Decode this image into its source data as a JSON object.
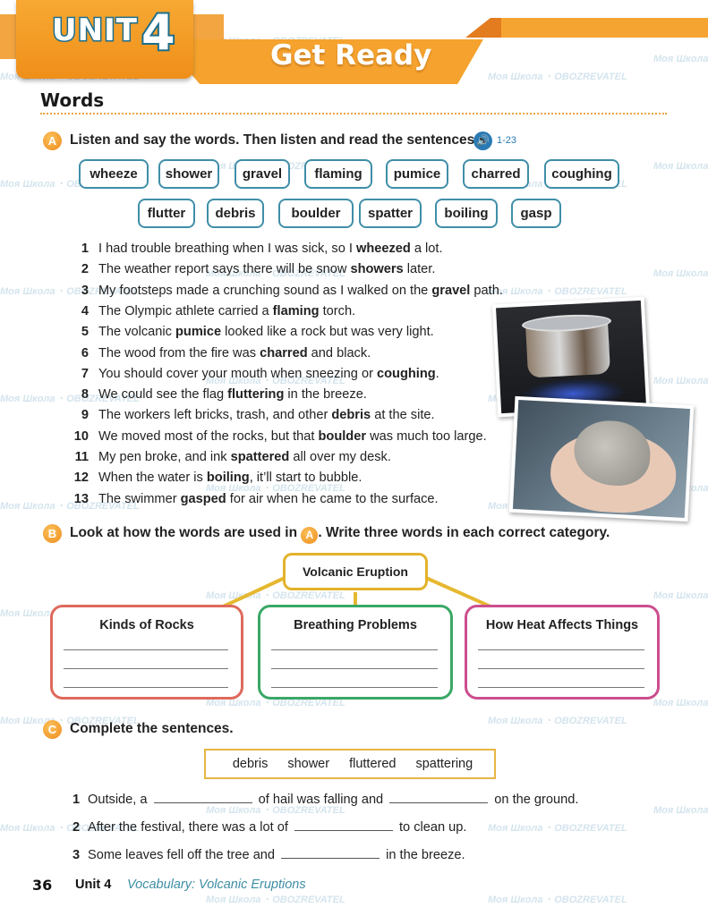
{
  "header": {
    "unit_label": "UNIT",
    "unit_number": "4",
    "title": "Get Ready",
    "section_heading": "Words"
  },
  "colors": {
    "accent_orange": "#f5a22e",
    "chip_border": "#3f8ea8",
    "center_box": "#e3b22b",
    "rocks_box": "#de6a5c",
    "breathing_box": "#3aa866",
    "heat_box": "#cc4f8e",
    "footer_topic": "#3e8ea5"
  },
  "section_a": {
    "badge": "A",
    "instruction": "Listen and say the words. Then listen and read the sentences.",
    "audio_icon": "audio-speaker-icon",
    "track": "1-23",
    "words_row1": [
      "wheeze",
      "shower",
      "gravel",
      "flaming",
      "pumice",
      "charred",
      "coughing"
    ],
    "words_row2": [
      "flutter",
      "debris",
      "boulder",
      "spatter",
      "boiling",
      "gasp"
    ],
    "sentences": [
      {
        "num": "1",
        "pre": "I had trouble breathing when I was sick, so I ",
        "bold": "wheezed",
        "post": " a lot."
      },
      {
        "num": "2",
        "pre": "The weather report says there will be snow ",
        "bold": "showers",
        "post": " later."
      },
      {
        "num": "3",
        "pre": "My footsteps made a crunching sound as I walked on the ",
        "bold": "gravel",
        "post": " path."
      },
      {
        "num": "4",
        "pre": "The Olympic athlete carried a ",
        "bold": "flaming",
        "post": " torch."
      },
      {
        "num": "5",
        "pre": "The volcanic ",
        "bold": "pumice",
        "post": " looked like a rock but was very light."
      },
      {
        "num": "6",
        "pre": "The wood from the fire was ",
        "bold": "charred",
        "post": " and black."
      },
      {
        "num": "7",
        "pre": "You should cover your mouth when sneezing or ",
        "bold": "coughing",
        "post": "."
      },
      {
        "num": "8",
        "pre": "We could see the flag ",
        "bold": "fluttering",
        "post": " in the breeze."
      },
      {
        "num": "9",
        "pre": "The workers left bricks, trash, and other ",
        "bold": "debris",
        "post": " at the site."
      },
      {
        "num": "10",
        "pre": "We moved most of the rocks, but that ",
        "bold": "boulder",
        "post": " was much too large."
      },
      {
        "num": "11",
        "pre": "My pen broke, and ink ",
        "bold": "spattered",
        "post": " all over my desk."
      },
      {
        "num": "12",
        "pre": "When the water is ",
        "bold": "boiling",
        "post": ", it’ll start to bubble."
      },
      {
        "num": "13",
        "pre": "The swimmer ",
        "bold": "gasped",
        "post": " for air when he came to the surface."
      }
    ],
    "photos": [
      "boiling-pot-photo",
      "pumice-in-hand-photo"
    ]
  },
  "section_b": {
    "badge": "B",
    "instruction_pre": "Look at how the words are used in",
    "ref_badge": "A",
    "instruction_post": ". Write three words in each correct category.",
    "center": "Volcanic Eruption",
    "categories": [
      {
        "title": "Kinds of Rocks",
        "answers": [
          "",
          "",
          ""
        ]
      },
      {
        "title": "Breathing Problems",
        "answers": [
          "",
          "",
          ""
        ]
      },
      {
        "title": "How Heat Affects Things",
        "answers": [
          "",
          "",
          ""
        ]
      }
    ]
  },
  "section_c": {
    "badge": "C",
    "instruction": "Complete the sentences.",
    "word_bank": [
      "debris",
      "shower",
      "fluttered",
      "spattering"
    ],
    "sentences": [
      {
        "num": "1",
        "parts": [
          "Outside, a ",
          "__",
          " of hail was falling and ",
          "__",
          " on the ground."
        ]
      },
      {
        "num": "2",
        "parts": [
          "After the festival, there was a lot of ",
          "__",
          " to clean up."
        ]
      },
      {
        "num": "3",
        "parts": [
          "Some leaves fell off the tree and ",
          "__",
          " in the breeze."
        ]
      }
    ]
  },
  "footer": {
    "page_number": "36",
    "unit": "Unit 4",
    "topic": "Vocabulary: Volcanic Eruptions"
  },
  "watermark": {
    "text1": "Моя Школа",
    "text2": "OBOZREVATEL"
  }
}
